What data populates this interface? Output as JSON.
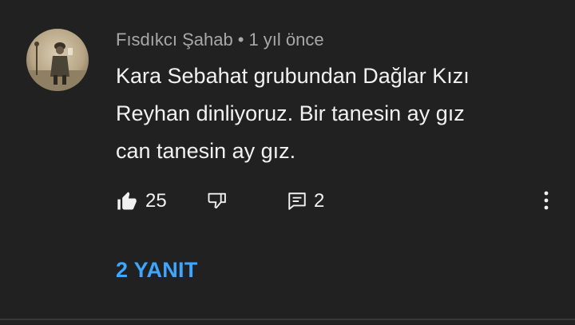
{
  "comment": {
    "author": "Fısdıkcı Şahab",
    "separator": "•",
    "time": "1 yıl önce",
    "text": "Kara Sebahat grubundan Dağlar Kızı\nReyhan dinliyoruz. Bir tanesin ay gız\ncan tanesin ay gız.",
    "likes": "25",
    "reply_count": "2",
    "replies_label": "2 YANIT"
  },
  "colors": {
    "background": "#212121",
    "text": "#f1f1f1",
    "meta": "#a8a8a8",
    "link": "#3ea6ff"
  },
  "icons": {
    "like": "thumbs-up-filled-icon",
    "dislike": "thumbs-down-outline-icon",
    "reply": "comment-icon",
    "more": "more-vertical-icon"
  }
}
